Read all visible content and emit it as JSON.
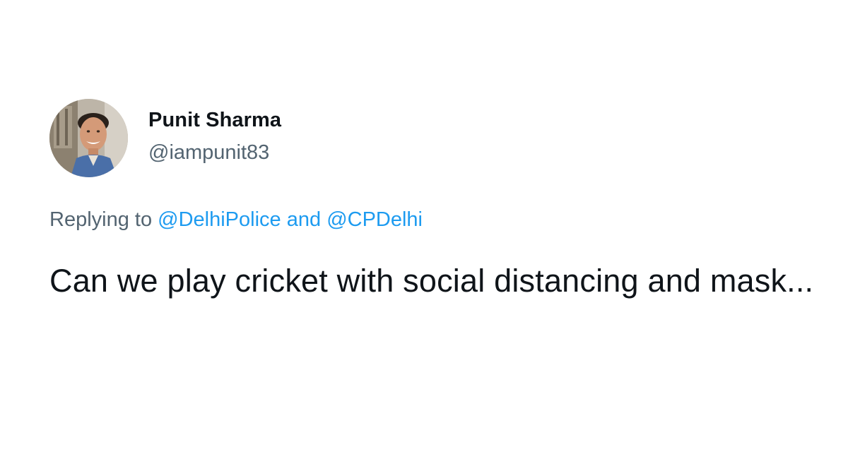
{
  "author": {
    "display_name": "Punit Sharma",
    "handle": "@iampunit83",
    "avatar_icon": "profile-photo"
  },
  "reply": {
    "prefix": "Replying to",
    "mention_1": "@DelhiPolice",
    "conjunction": "and",
    "mention_2": "@CPDelhi"
  },
  "tweet": {
    "text": "Can we play cricket with social distancing and mask..."
  },
  "colors": {
    "text_primary": "#0f1419",
    "text_secondary": "#536471",
    "link": "#1d9bf0",
    "background": "#ffffff"
  }
}
